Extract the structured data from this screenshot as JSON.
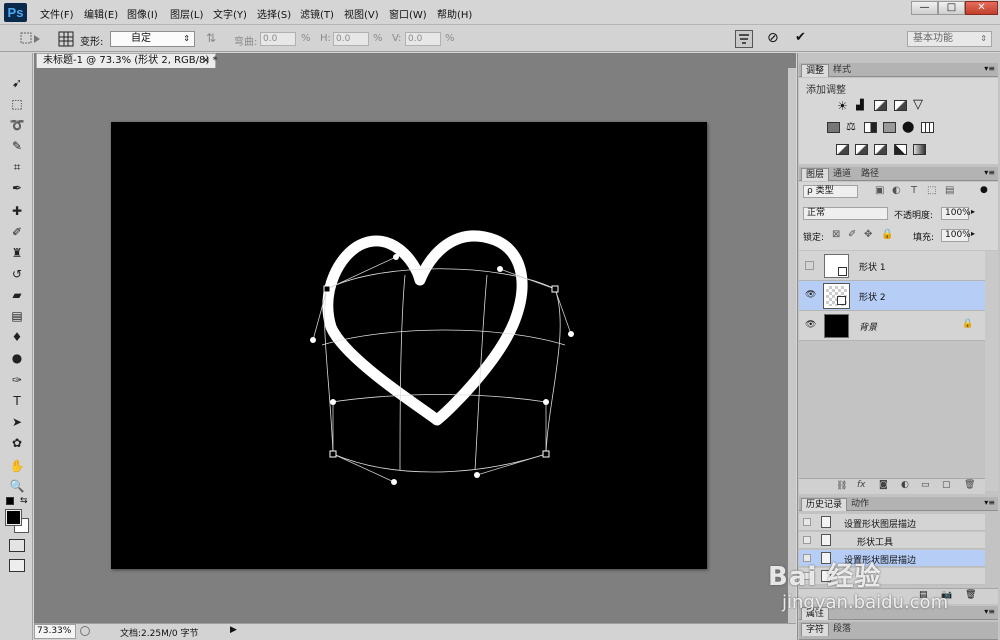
{
  "app": {
    "logo": "Ps"
  },
  "menu": [
    "文件(F)",
    "编辑(E)",
    "图像(I)",
    "图层(L)",
    "文字(Y)",
    "选择(S)",
    "滤镜(T)",
    "视图(V)",
    "窗口(W)",
    "帮助(H)"
  ],
  "window_controls": {
    "minimize": "—",
    "maximize": "□",
    "close": "✕"
  },
  "options": {
    "warp_label": "变形:",
    "warp_value": "自定",
    "bend_label": "弯曲:",
    "bend_value": "0.0",
    "bend_unit": "%",
    "h_label": "H:",
    "h_value": "0.0",
    "h_unit": "%",
    "v_label": "V:",
    "v_value": "0.0",
    "v_unit": "%",
    "cancel_icon": "⊘",
    "commit_icon": "✔",
    "workspace": "基本功能"
  },
  "document": {
    "tab_title": "未标题-1 @ 73.3% (形状 2, RGB/8) *",
    "tab_close": "×",
    "canvas_color": "#000000"
  },
  "status": {
    "zoom": "73.33%",
    "doc_info": "文档:2.25M/0 字节"
  },
  "panels": {
    "adjust_tabs": [
      "调整",
      "样式"
    ],
    "adjust_title": "添加调整",
    "layers_tabs": [
      "图层",
      "通道",
      "路径"
    ],
    "filter_kind": "类型",
    "blend_mode": "正常",
    "opacity_label": "不透明度:",
    "opacity_value": "100%",
    "lock_label": "锁定:",
    "fill_label": "填充:",
    "fill_value": "100%",
    "layers": [
      {
        "name": "形状 1",
        "visible": false,
        "selected": false
      },
      {
        "name": "形状 2",
        "visible": true,
        "selected": true
      },
      {
        "name": "背景",
        "visible": true,
        "selected": false,
        "locked": true
      }
    ],
    "history_tabs": [
      "历史记录",
      "动作"
    ],
    "history": [
      {
        "label": "设置形状图层描边",
        "selected": false
      },
      {
        "label": "形状工具",
        "selected": false
      },
      {
        "label": "设置形状图层描边",
        "selected": true
      },
      {
        "label": "",
        "selected": false
      }
    ],
    "bottom_tabs_1": [
      "属性"
    ],
    "bottom_tabs_2": [
      "字符",
      "段落"
    ]
  },
  "watermark": {
    "brand": "Bai  经验",
    "url": "jingyan.baidu.com"
  },
  "colors": {
    "accent_select": "#b6cdf5",
    "canvas": "#000000",
    "workspace_bg": "#7f7f7f"
  }
}
